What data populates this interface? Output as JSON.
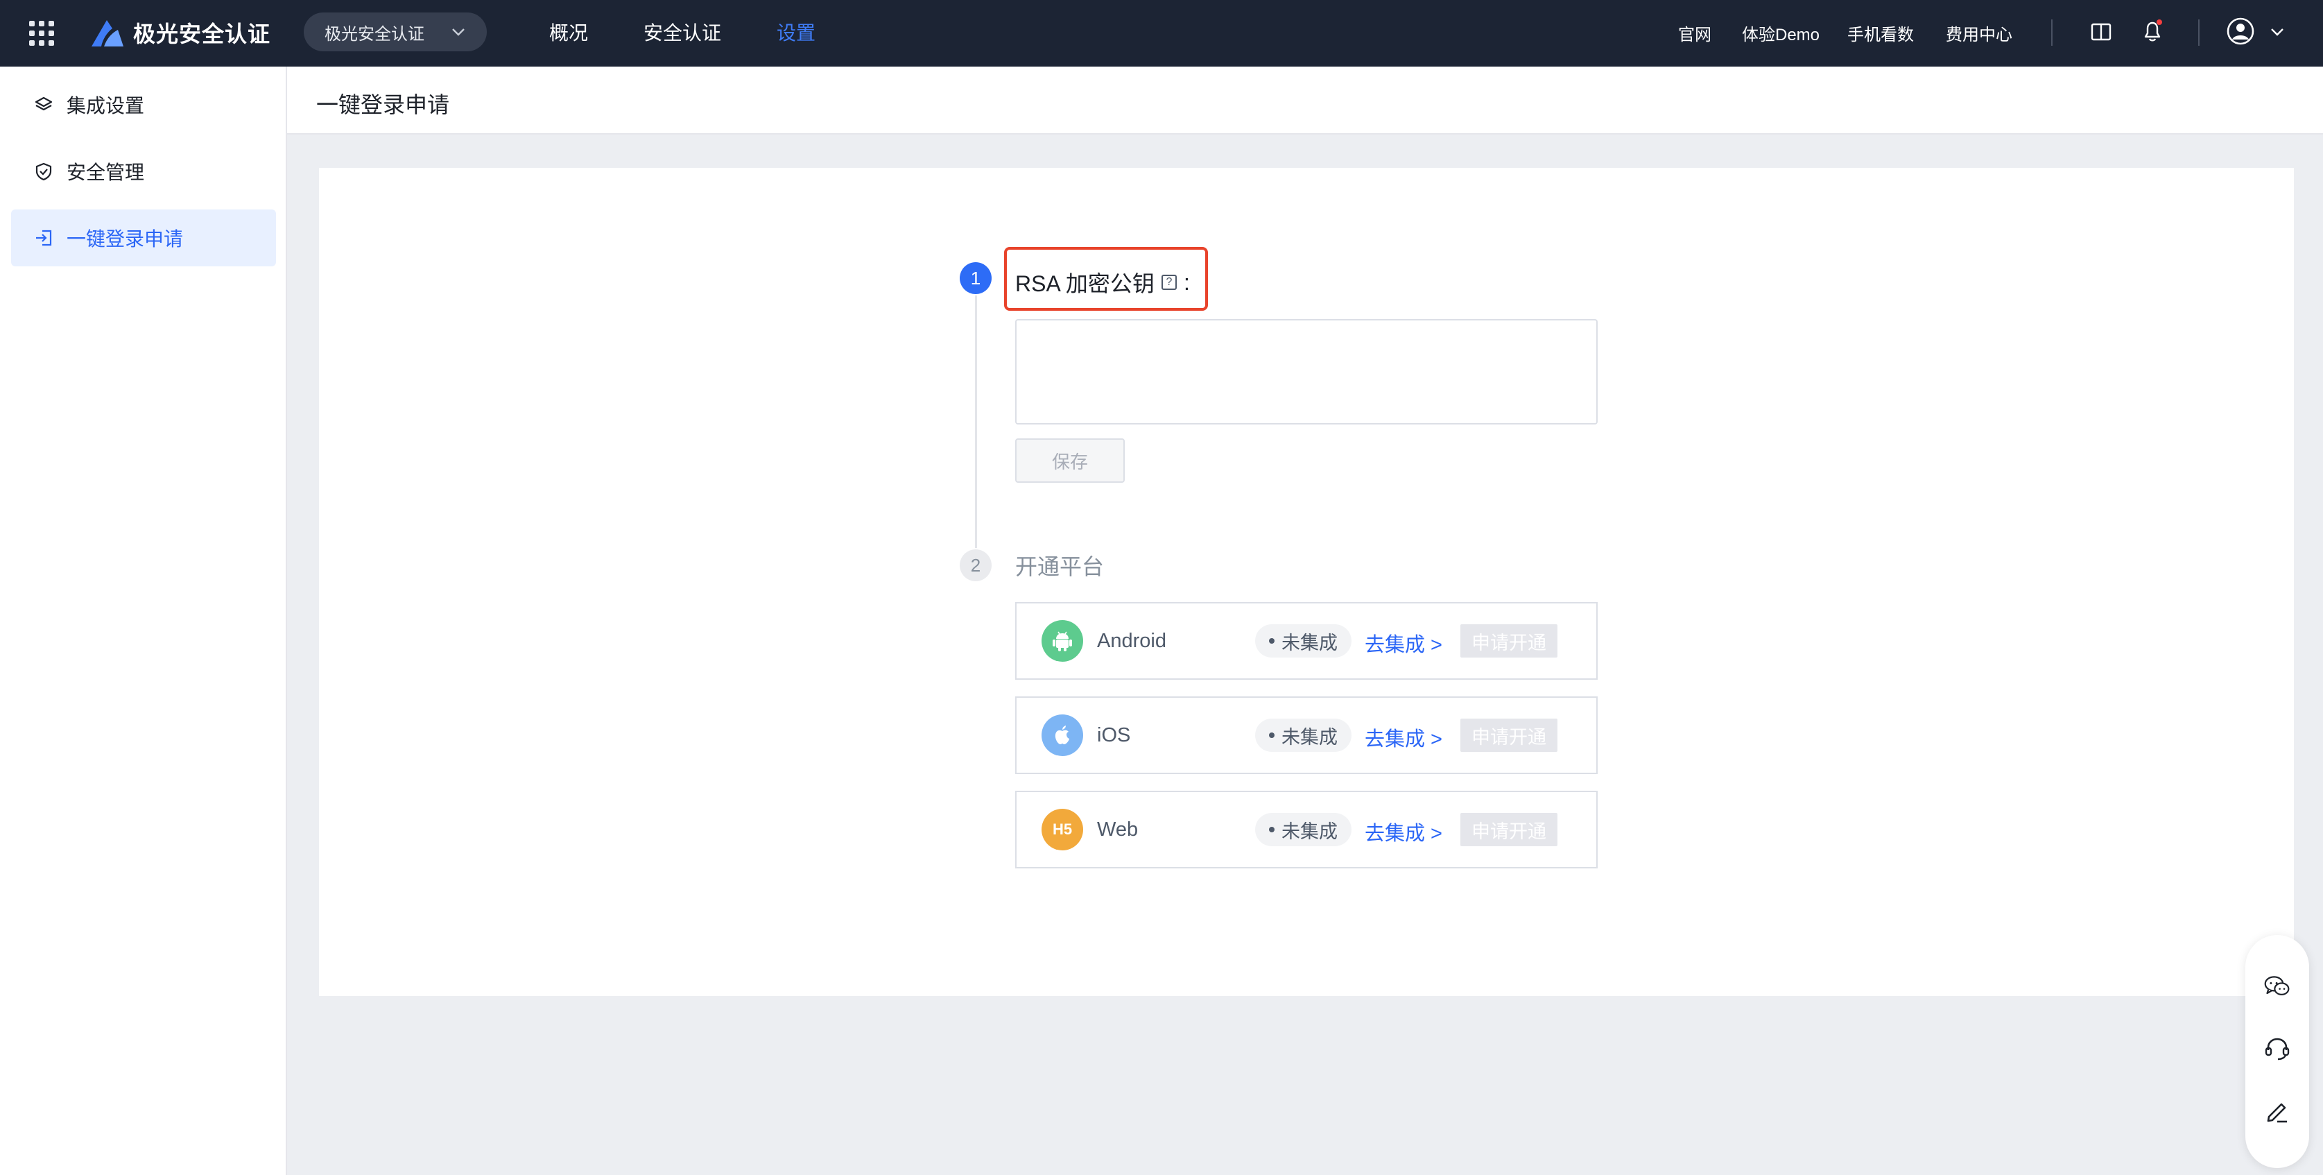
{
  "topbar": {
    "brand_name": "极光安全认证",
    "product_switch": "极光安全认证",
    "nav": [
      {
        "label": "概况",
        "active": false
      },
      {
        "label": "安全认证",
        "active": false
      },
      {
        "label": "设置",
        "active": true
      }
    ],
    "links": [
      "官网",
      "体验Demo",
      "手机看数",
      "费用中心"
    ]
  },
  "sidebar": {
    "items": [
      {
        "label": "集成设置",
        "icon": "layers-icon",
        "active": false
      },
      {
        "label": "安全管理",
        "icon": "shield-check-icon",
        "active": false
      },
      {
        "label": "一键登录申请",
        "icon": "login-icon",
        "active": true
      }
    ]
  },
  "page": {
    "title": "一键登录申请"
  },
  "steps": {
    "step1": {
      "number": "1",
      "label": "RSA 加密公钥",
      "help_icon": "?",
      "colon": ":",
      "textarea_value": "",
      "save_label": "保存"
    },
    "step2": {
      "number": "2",
      "label": "开通平台"
    }
  },
  "platforms": [
    {
      "name": "Android",
      "icon": "android-icon",
      "icon_color": "#5dcb8e",
      "status": "未集成",
      "link": "去集成 >",
      "apply": "申请开通"
    },
    {
      "name": "iOS",
      "icon": "apple-icon",
      "icon_color": "#7db5f4",
      "status": "未集成",
      "link": "去集成 >",
      "apply": "申请开通"
    },
    {
      "name": "Web",
      "icon": "h5-icon",
      "icon_text": "H5",
      "icon_color": "#f2a93b",
      "status": "未集成",
      "link": "去集成 >",
      "apply": "申请开通"
    }
  ],
  "colors": {
    "topbar_bg": "#1c2434",
    "accent": "#2d6cf6",
    "highlight_border": "#e8432b"
  },
  "float_tools": [
    "wechat-icon",
    "headset-icon",
    "edit-icon"
  ]
}
